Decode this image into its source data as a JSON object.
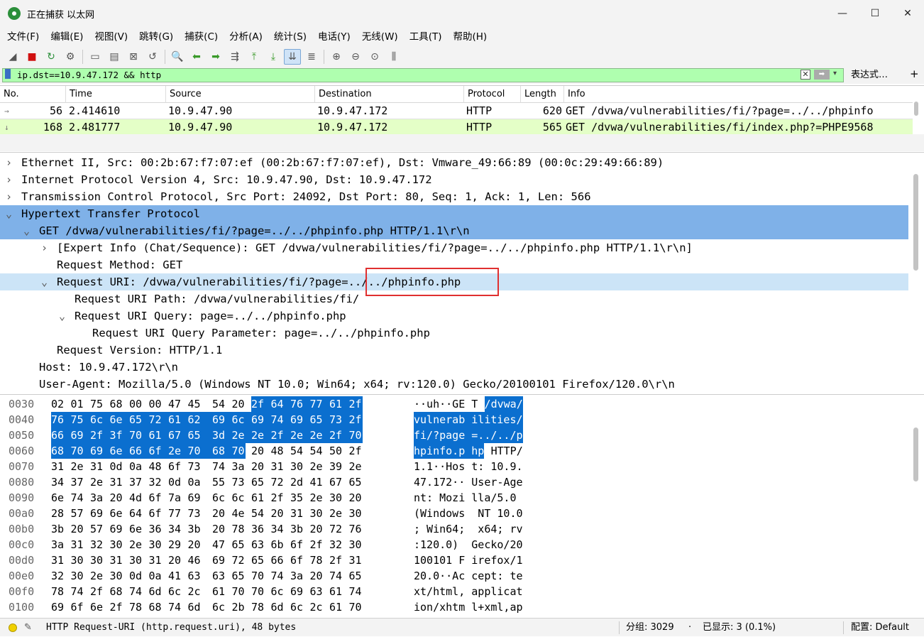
{
  "window": {
    "title": "正在捕获 以太网",
    "controls": {
      "minimize": "—",
      "maximize": "☐",
      "close": "✕"
    }
  },
  "menu": [
    "文件(F)",
    "编辑(E)",
    "视图(V)",
    "跳转(G)",
    "捕获(C)",
    "分析(A)",
    "统计(S)",
    "电话(Y)",
    "无线(W)",
    "工具(T)",
    "帮助(H)"
  ],
  "toolbar": [
    {
      "name": "start-capture-icon",
      "glyph": "◢"
    },
    {
      "name": "stop-capture-icon",
      "glyph": "■"
    },
    {
      "name": "restart-capture-icon",
      "glyph": "↻"
    },
    {
      "name": "capture-options-icon",
      "glyph": "⚙"
    },
    {
      "name": "open-file-icon",
      "glyph": "▭"
    },
    {
      "name": "save-file-icon",
      "glyph": "▤"
    },
    {
      "name": "close-file-icon",
      "glyph": "⊠"
    },
    {
      "name": "reload-file-icon",
      "glyph": "↺"
    },
    {
      "name": "find-packet-icon",
      "glyph": "🔍"
    },
    {
      "name": "go-back-icon",
      "glyph": "⬅"
    },
    {
      "name": "go-forward-icon",
      "glyph": "➡"
    },
    {
      "name": "go-to-packet-icon",
      "glyph": "⇶"
    },
    {
      "name": "first-packet-icon",
      "glyph": "⤒"
    },
    {
      "name": "last-packet-icon",
      "glyph": "⤓"
    },
    {
      "name": "auto-scroll-icon",
      "glyph": "⇊"
    },
    {
      "name": "colorize-icon",
      "glyph": "≣"
    },
    {
      "name": "zoom-in-icon",
      "glyph": "⊕"
    },
    {
      "name": "zoom-out-icon",
      "glyph": "⊖"
    },
    {
      "name": "normal-size-icon",
      "glyph": "⊙"
    },
    {
      "name": "resize-columns-icon",
      "glyph": "⫼"
    }
  ],
  "filter": {
    "value": "ip.dst==10.9.47.172 && http",
    "clear": "✕",
    "apply": "➡",
    "dropdown": "▾",
    "expressions_label": "表达式…",
    "add": "+"
  },
  "packet_list": {
    "columns": [
      "No.",
      "Time",
      "Source",
      "Destination",
      "Protocol",
      "Length",
      "Info"
    ],
    "rows": [
      {
        "no": "56",
        "time": "2.414610",
        "source": "10.9.47.90",
        "destination": "10.9.47.172",
        "protocol": "HTTP",
        "length": "620",
        "info": "GET /dvwa/vulnerabilities/fi/?page=../../phpinfo",
        "marker": "→"
      },
      {
        "no": "168",
        "time": "2.481777",
        "source": "10.9.47.90",
        "destination": "10.9.47.172",
        "protocol": "HTTP",
        "length": "565",
        "info": "GET /dvwa/vulnerabilities/fi/index.php?=PHPE9568",
        "marker": "↓"
      }
    ]
  },
  "details": [
    {
      "text": "Ethernet II, Src: 00:2b:67:f7:07:ef (00:2b:67:f7:07:ef), Dst: Vmware_49:66:89 (00:0c:29:49:66:89)",
      "level": 0,
      "arrow": "›",
      "state": ""
    },
    {
      "text": "Internet Protocol Version 4, Src: 10.9.47.90, Dst: 10.9.47.172",
      "level": 0,
      "arrow": "›",
      "state": ""
    },
    {
      "text": "Transmission Control Protocol, Src Port: 24092, Dst Port: 80, Seq: 1, Ack: 1, Len: 566",
      "level": 0,
      "arrow": "›",
      "state": ""
    },
    {
      "text": "Hypertext Transfer Protocol",
      "level": 0,
      "arrow": "⌄",
      "state": "sel"
    },
    {
      "text": "GET /dvwa/vulnerabilities/fi/?page=../../phpinfo.php HTTP/1.1\\r\\n",
      "level": 1,
      "arrow": "⌄",
      "state": "sel"
    },
    {
      "text": "[Expert Info (Chat/Sequence): GET /dvwa/vulnerabilities/fi/?page=../../phpinfo.php HTTP/1.1\\r\\n]",
      "level": 2,
      "arrow": "›",
      "state": ""
    },
    {
      "text": "Request Method: GET",
      "level": 2,
      "arrow": "",
      "state": ""
    },
    {
      "text": "Request URI: /dvwa/vulnerabilities/fi/?page=../../phpinfo.php",
      "level": 2,
      "arrow": "⌄",
      "state": "hl"
    },
    {
      "text": "Request URI Path: /dvwa/vulnerabilities/fi/",
      "level": 3,
      "arrow": "",
      "state": ""
    },
    {
      "text": "Request URI Query: page=../../phpinfo.php",
      "level": 3,
      "arrow": "⌄",
      "state": ""
    },
    {
      "text": "Request URI Query Parameter: page=../../phpinfo.php",
      "level": 4,
      "arrow": "",
      "state": ""
    },
    {
      "text": "Request Version: HTTP/1.1",
      "level": 2,
      "arrow": "",
      "state": ""
    },
    {
      "text": "Host: 10.9.47.172\\r\\n",
      "level": 1,
      "arrow": "",
      "state": ""
    },
    {
      "text": "User-Agent: Mozilla/5.0 (Windows NT 10.0; Win64; x64; rv:120.0) Gecko/20100101 Firefox/120.0\\r\\n",
      "level": 1,
      "arrow": "",
      "state": ""
    }
  ],
  "bytes": [
    {
      "offset": "0030",
      "hex": [
        "02",
        "01",
        "75",
        "68",
        "00",
        "00",
        "47",
        "45",
        "54",
        "20",
        "2f",
        "64",
        "76",
        "77",
        "61",
        "2f"
      ],
      "ascii": "··uh··GE T /dvwa/",
      "sel_from": 10,
      "sel_to": 16
    },
    {
      "offset": "0040",
      "hex": [
        "76",
        "75",
        "6c",
        "6e",
        "65",
        "72",
        "61",
        "62",
        "69",
        "6c",
        "69",
        "74",
        "69",
        "65",
        "73",
        "2f"
      ],
      "ascii": "vulnerab ilities/",
      "sel_from": 0,
      "sel_to": 16
    },
    {
      "offset": "0050",
      "hex": [
        "66",
        "69",
        "2f",
        "3f",
        "70",
        "61",
        "67",
        "65",
        "3d",
        "2e",
        "2e",
        "2f",
        "2e",
        "2e",
        "2f",
        "70"
      ],
      "ascii": "fi/?page =../../p",
      "sel_from": 0,
      "sel_to": 16
    },
    {
      "offset": "0060",
      "hex": [
        "68",
        "70",
        "69",
        "6e",
        "66",
        "6f",
        "2e",
        "70",
        "68",
        "70",
        "20",
        "48",
        "54",
        "54",
        "50",
        "2f"
      ],
      "ascii": "hpinfo.p hp HTTP/",
      "sel_from": 0,
      "sel_to": 10
    },
    {
      "offset": "0070",
      "hex": [
        "31",
        "2e",
        "31",
        "0d",
        "0a",
        "48",
        "6f",
        "73",
        "74",
        "3a",
        "20",
        "31",
        "30",
        "2e",
        "39",
        "2e"
      ],
      "ascii": "1.1··Hos t: 10.9.",
      "sel_from": 0,
      "sel_to": 0
    },
    {
      "offset": "0080",
      "hex": [
        "34",
        "37",
        "2e",
        "31",
        "37",
        "32",
        "0d",
        "0a",
        "55",
        "73",
        "65",
        "72",
        "2d",
        "41",
        "67",
        "65"
      ],
      "ascii": "47.172·· User-Age",
      "sel_from": 0,
      "sel_to": 0
    },
    {
      "offset": "0090",
      "hex": [
        "6e",
        "74",
        "3a",
        "20",
        "4d",
        "6f",
        "7a",
        "69",
        "6c",
        "6c",
        "61",
        "2f",
        "35",
        "2e",
        "30",
        "20"
      ],
      "ascii": "nt: Mozi lla/5.0 ",
      "sel_from": 0,
      "sel_to": 0
    },
    {
      "offset": "00a0",
      "hex": [
        "28",
        "57",
        "69",
        "6e",
        "64",
        "6f",
        "77",
        "73",
        "20",
        "4e",
        "54",
        "20",
        "31",
        "30",
        "2e",
        "30"
      ],
      "ascii": "(Windows  NT 10.0",
      "sel_from": 0,
      "sel_to": 0
    },
    {
      "offset": "00b0",
      "hex": [
        "3b",
        "20",
        "57",
        "69",
        "6e",
        "36",
        "34",
        "3b",
        "20",
        "78",
        "36",
        "34",
        "3b",
        "20",
        "72",
        "76"
      ],
      "ascii": "; Win64;  x64; rv",
      "sel_from": 0,
      "sel_to": 0
    },
    {
      "offset": "00c0",
      "hex": [
        "3a",
        "31",
        "32",
        "30",
        "2e",
        "30",
        "29",
        "20",
        "47",
        "65",
        "63",
        "6b",
        "6f",
        "2f",
        "32",
        "30"
      ],
      "ascii": ":120.0)  Gecko/20",
      "sel_from": 0,
      "sel_to": 0
    },
    {
      "offset": "00d0",
      "hex": [
        "31",
        "30",
        "30",
        "31",
        "30",
        "31",
        "20",
        "46",
        "69",
        "72",
        "65",
        "66",
        "6f",
        "78",
        "2f",
        "31"
      ],
      "ascii": "100101 F irefox/1",
      "sel_from": 0,
      "sel_to": 0
    },
    {
      "offset": "00e0",
      "hex": [
        "32",
        "30",
        "2e",
        "30",
        "0d",
        "0a",
        "41",
        "63",
        "63",
        "65",
        "70",
        "74",
        "3a",
        "20",
        "74",
        "65"
      ],
      "ascii": "20.0··Ac cept: te",
      "sel_from": 0,
      "sel_to": 0
    },
    {
      "offset": "00f0",
      "hex": [
        "78",
        "74",
        "2f",
        "68",
        "74",
        "6d",
        "6c",
        "2c",
        "61",
        "70",
        "70",
        "6c",
        "69",
        "63",
        "61",
        "74"
      ],
      "ascii": "xt/html, applicat",
      "sel_from": 0,
      "sel_to": 0
    },
    {
      "offset": "0100",
      "hex": [
        "69",
        "6f",
        "6e",
        "2f",
        "78",
        "68",
        "74",
        "6d",
        "6c",
        "2b",
        "78",
        "6d",
        "6c",
        "2c",
        "61",
        "70"
      ],
      "ascii": "ion/xhtm l+xml,ap",
      "sel_from": 0,
      "sel_to": 0
    }
  ],
  "status": {
    "field_info": "HTTP Request-URI (http.request.uri), 48 bytes",
    "packets": "分组: 3029",
    "displayed": "已显示: 3 (0.1%)",
    "profile": "配置: Default"
  },
  "colors": {
    "filter_valid": "#afffaf",
    "selected_tree": "#7fb1e8",
    "highlight_tree": "#cce4f7",
    "bytes_selected": "#0b6fcf",
    "annotation_box": "#e03030",
    "row_green": "#e4ffc7"
  }
}
